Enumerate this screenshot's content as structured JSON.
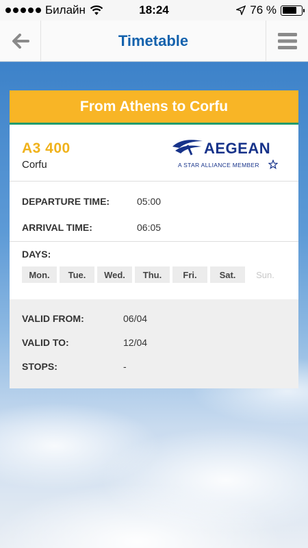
{
  "status": {
    "carrier": "Билайн",
    "time": "18:24",
    "battery_label": "76 %",
    "battery_level": 0.76
  },
  "nav": {
    "title": "Timetable"
  },
  "card": {
    "header": "From Athens to Corfu",
    "flight_number": "A3 400",
    "destination": "Corfu",
    "airline_logo": {
      "name": "AEGEAN",
      "subtitle": "A STAR ALLIANCE MEMBER"
    },
    "departure_label": "DEPARTURE TIME:",
    "departure_value": "05:00",
    "arrival_label": "ARRIVAL TIME:",
    "arrival_value": "06:05",
    "days_label": "DAYS:",
    "days": [
      "Mon.",
      "Tue.",
      "Wed.",
      "Thu.",
      "Fri.",
      "Sat.",
      "Sun."
    ],
    "days_active": [
      true,
      true,
      true,
      true,
      true,
      true,
      false
    ],
    "valid_from_label": "VALID FROM:",
    "valid_from_value": "06/04",
    "valid_to_label": "VALID TO:",
    "valid_to_value": "12/04",
    "stops_label": "STOPS:",
    "stops_value": "-"
  },
  "colors": {
    "accent_yellow": "#f8b526",
    "title_blue": "#1462ad",
    "flight_number": "#f0b21b"
  },
  "icons": {
    "back": "arrow-left-icon",
    "menu": "hamburger-menu-icon",
    "wifi": "wifi-icon",
    "location": "location-arrow-icon",
    "battery": "battery-icon"
  }
}
